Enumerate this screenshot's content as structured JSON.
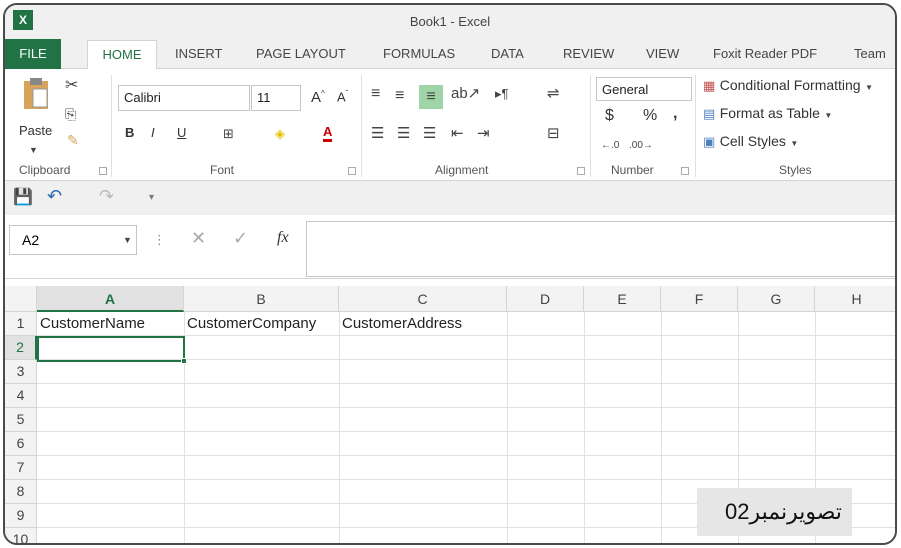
{
  "window": {
    "app_icon": "X",
    "title": "Book1 - Excel"
  },
  "tabs": {
    "file": "FILE",
    "home": "HOME",
    "insert": "INSERT",
    "page_layout": "PAGE LAYOUT",
    "formulas": "FORMULAS",
    "data": "DATA",
    "review": "REVIEW",
    "view": "VIEW",
    "foxit": "Foxit Reader PDF",
    "team": "Team"
  },
  "clipboard": {
    "paste": "Paste",
    "label": "Clipboard"
  },
  "font": {
    "name": "Calibri",
    "size": "11",
    "bold": "B",
    "italic": "I",
    "underline": "U",
    "color_letter": "A",
    "label": "Font"
  },
  "alignment": {
    "label": "Alignment"
  },
  "number": {
    "format": "General",
    "currency": "$",
    "percent": "%",
    "comma": ",",
    "label": "Number"
  },
  "styles": {
    "conditional": "Conditional Formatting",
    "format_table": "Format as Table",
    "cell_styles": "Cell Styles",
    "label": "Styles"
  },
  "formula_bar": {
    "name_box": "A2",
    "fx": "fx",
    "value": ""
  },
  "sheet": {
    "columns": [
      "A",
      "B",
      "C",
      "D",
      "E",
      "F",
      "G",
      "H"
    ],
    "rows": [
      "1",
      "2",
      "3",
      "4",
      "5",
      "6",
      "7",
      "8",
      "9",
      "10"
    ],
    "cells": {
      "A1": "CustomerName",
      "B1": "CustomerCompany",
      "C1": "CustomerAddress"
    },
    "active_cell": "A2"
  },
  "watermark": "تصویرنمبر02",
  "colors": {
    "excel_green": "#217346",
    "selection": "#217346"
  }
}
